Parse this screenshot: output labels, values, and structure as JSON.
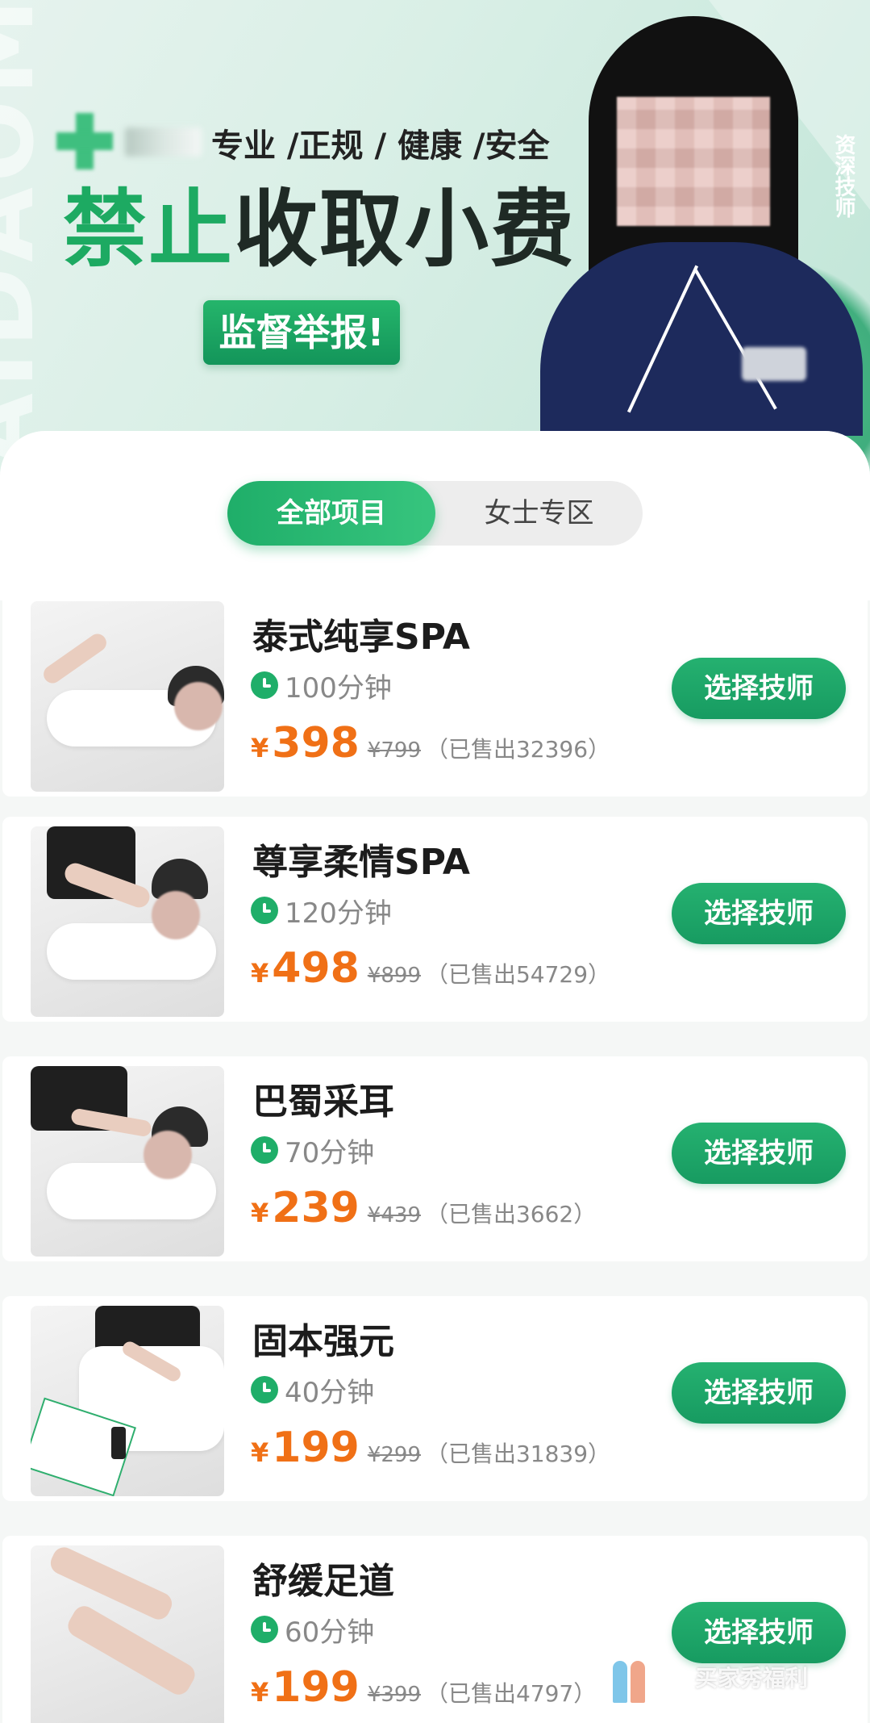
{
  "banner": {
    "watermark": "AIDAOM",
    "slogan": "专业 /正规 / 健康 /安全",
    "headline_green": "禁止",
    "headline_dark": "收取小费",
    "report_button": "监督举报!",
    "tech_label": "资深技师"
  },
  "tabs": [
    {
      "label": "全部项目",
      "active": true
    },
    {
      "label": "女士专区",
      "active": false
    }
  ],
  "services": [
    {
      "title": "泰式纯享SPA",
      "duration": "100分钟",
      "currency": "¥",
      "price": "398",
      "original_price": "¥799",
      "sold": "（已售出32396）",
      "button": "选择技师"
    },
    {
      "title": "尊享柔情SPA",
      "duration": "120分钟",
      "currency": "¥",
      "price": "498",
      "original_price": "¥899",
      "sold": "（已售出54729）",
      "button": "选择技师"
    },
    {
      "title": "巴蜀采耳",
      "duration": "70分钟",
      "currency": "¥",
      "price": "239",
      "original_price": "¥439",
      "sold": "（已售出3662）",
      "button": "选择技师"
    },
    {
      "title": "固本强元",
      "duration": "40分钟",
      "currency": "¥",
      "price": "199",
      "original_price": "¥299",
      "sold": "（已售出31839）",
      "button": "选择技师"
    },
    {
      "title": "舒缓足道",
      "duration": "60分钟",
      "currency": "¥",
      "price": "199",
      "original_price": "¥399",
      "sold": "（已售出4797）",
      "button": "选择技师"
    }
  ],
  "overlay_watermark": "买家秀福利",
  "colors": {
    "accent_green": "#1fae69",
    "price_orange": "#f07016",
    "headline_green": "#1daa62"
  }
}
